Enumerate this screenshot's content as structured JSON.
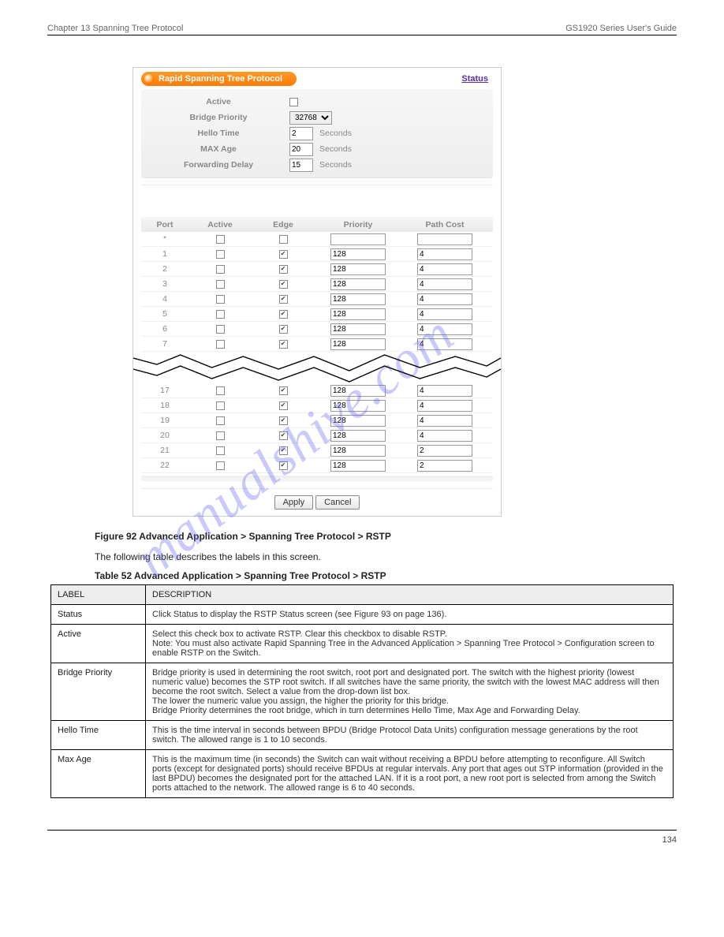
{
  "header": {
    "left": "Chapter 13 Spanning Tree Protocol",
    "right": "GS1920 Series User's Guide"
  },
  "panel": {
    "title": "Rapid Spanning Tree Protocol",
    "status_link": "Status",
    "settings": {
      "active_label": "Active",
      "bridge_priority_label": "Bridge Priority",
      "bridge_priority_value": "32768",
      "hello_time_label": "Hello Time",
      "hello_time_value": "2",
      "max_age_label": "MAX Age",
      "max_age_value": "20",
      "forwarding_delay_label": "Forwarding Delay",
      "forwarding_delay_value": "15",
      "seconds": "Seconds"
    },
    "columns": {
      "port": "Port",
      "active": "Active",
      "edge": "Edge",
      "priority": "Priority",
      "path_cost": "Path Cost"
    },
    "rows_top": [
      {
        "port": "*",
        "active": false,
        "edge": false,
        "priority": "",
        "path_cost": ""
      },
      {
        "port": "1",
        "active": false,
        "edge": true,
        "priority": "128",
        "path_cost": "4"
      },
      {
        "port": "2",
        "active": false,
        "edge": true,
        "priority": "128",
        "path_cost": "4"
      },
      {
        "port": "3",
        "active": false,
        "edge": true,
        "priority": "128",
        "path_cost": "4"
      },
      {
        "port": "4",
        "active": false,
        "edge": true,
        "priority": "128",
        "path_cost": "4"
      },
      {
        "port": "5",
        "active": false,
        "edge": true,
        "priority": "128",
        "path_cost": "4"
      },
      {
        "port": "6",
        "active": false,
        "edge": true,
        "priority": "128",
        "path_cost": "4"
      },
      {
        "port": "7",
        "active": false,
        "edge": true,
        "priority": "128",
        "path_cost": "4"
      }
    ],
    "rows_bottom": [
      {
        "port": "17",
        "active": false,
        "edge": true,
        "priority": "128",
        "path_cost": "4"
      },
      {
        "port": "18",
        "active": false,
        "edge": true,
        "priority": "128",
        "path_cost": "4"
      },
      {
        "port": "19",
        "active": false,
        "edge": true,
        "priority": "128",
        "path_cost": "4"
      },
      {
        "port": "20",
        "active": false,
        "edge": true,
        "priority": "128",
        "path_cost": "4"
      },
      {
        "port": "21",
        "active": false,
        "edge": true,
        "priority": "128",
        "path_cost": "2"
      },
      {
        "port": "22",
        "active": false,
        "edge": true,
        "priority": "128",
        "path_cost": "2"
      }
    ],
    "buttons": {
      "apply": "Apply",
      "cancel": "Cancel"
    }
  },
  "figure_caption": "Figure 92   Advanced Application > Spanning Tree Protocol > RSTP",
  "intro": "The following table describes the labels in this screen.",
  "table_caption": "Table 52   Advanced Application > Spanning Tree Protocol > RSTP",
  "desc_table": {
    "head": {
      "label": "LABEL",
      "description": "DESCRIPTION"
    },
    "rows": [
      {
        "label": "Status",
        "desc": "Click Status to display the RSTP Status screen (see Figure 93 on page 136)."
      },
      {
        "label": "Active",
        "desc": "Select this check box to activate RSTP. Clear this checkbox to disable RSTP.\nNote: You must also activate Rapid Spanning Tree in the Advanced Application > Spanning Tree Protocol > Configuration screen to enable RSTP on the Switch."
      },
      {
        "label": "Bridge Priority",
        "desc": "Bridge priority is used in determining the root switch, root port and designated port. The switch with the highest priority (lowest numeric value) becomes the STP root switch. If all switches have the same priority, the switch with the lowest MAC address will then become the root switch. Select a value from the drop-down list box.\nThe lower the numeric value you assign, the higher the priority for this bridge.\nBridge Priority determines the root bridge, which in turn determines Hello Time, Max Age and Forwarding Delay."
      },
      {
        "label": "Hello Time",
        "desc": "This is the time interval in seconds between BPDU (Bridge Protocol Data Units) configuration message generations by the root switch. The allowed range is 1 to 10 seconds."
      },
      {
        "label": "Max Age",
        "desc": "This is the maximum time (in seconds) the Switch can wait without receiving a BPDU before attempting to reconfigure. All Switch ports (except for designated ports) should receive BPDUs at regular intervals. Any port that ages out STP information (provided in the last BPDU) becomes the designated port for the attached LAN. If it is a root port, a new root port is selected from among the Switch ports attached to the network. The allowed range is 6 to 40 seconds."
      }
    ]
  },
  "footer": {
    "left": "",
    "right": "134"
  },
  "watermark": "manualshive.com"
}
